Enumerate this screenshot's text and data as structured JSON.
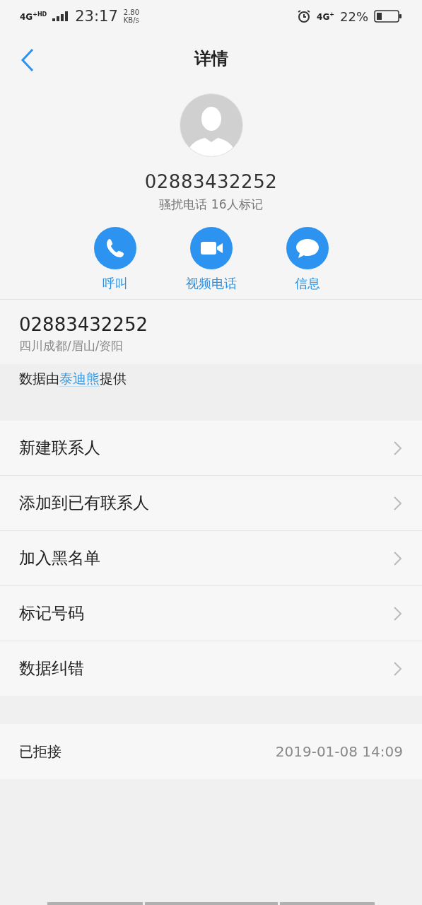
{
  "status_bar": {
    "network": "4G$^{+HD}$",
    "time": "23:17",
    "speed_value": "2.80",
    "speed_unit": "KB/s",
    "network_right": "4G$^{+}$",
    "battery": "22%"
  },
  "header": {
    "title": "详情"
  },
  "contact": {
    "number": "02883432252",
    "tag": "骚扰电话 16人标记"
  },
  "actions": [
    {
      "kind": "call",
      "label": "呼叫"
    },
    {
      "kind": "video",
      "label": "视频电话"
    },
    {
      "kind": "message",
      "label": "信息"
    }
  ],
  "number_info": {
    "number": "02883432252",
    "location": "四川成都/眉山/资阳",
    "provider_note": "数据由**泰迪熊**提供"
  },
  "menu": [
    {
      "label": "新建联系人"
    },
    {
      "label": "添加到已有联系人"
    },
    {
      "label": "加入黑名单"
    },
    {
      "label": "标记号码"
    },
    {
      "label": "数据纠错"
    }
  ],
  "history": {
    "status": "已拒接",
    "time": "2019-01-08 14:09"
  }
}
